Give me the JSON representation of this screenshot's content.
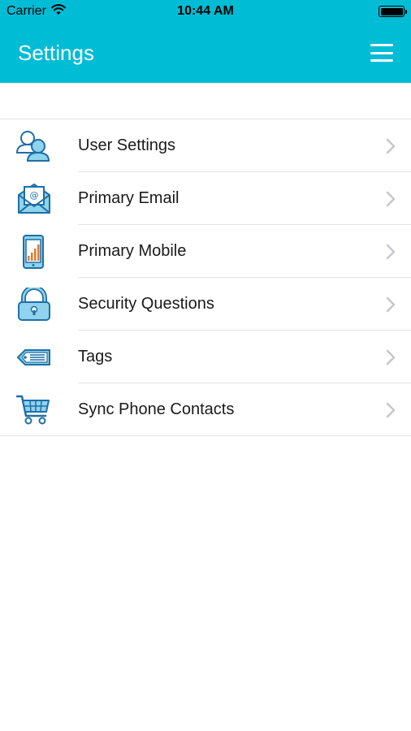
{
  "status_bar": {
    "carrier": "Carrier",
    "time": "10:44 AM"
  },
  "header": {
    "title": "Settings",
    "menu_icon": "hamburger-menu-icon"
  },
  "colors": {
    "accent": "#00bcd4",
    "icon_blue": "#1e6fa8",
    "icon_fill": "#8fd3ec",
    "chevron": "#c7c7cc",
    "divider": "#e3e3e3"
  },
  "settings": {
    "items": [
      {
        "label": "User Settings",
        "icon": "users-icon"
      },
      {
        "label": "Primary Email",
        "icon": "email-envelope-icon"
      },
      {
        "label": "Primary Mobile",
        "icon": "mobile-phone-icon"
      },
      {
        "label": "Security Questions",
        "icon": "padlock-icon"
      },
      {
        "label": "Tags",
        "icon": "tag-icon"
      },
      {
        "label": "Sync Phone Contacts",
        "icon": "shopping-cart-icon"
      }
    ]
  }
}
